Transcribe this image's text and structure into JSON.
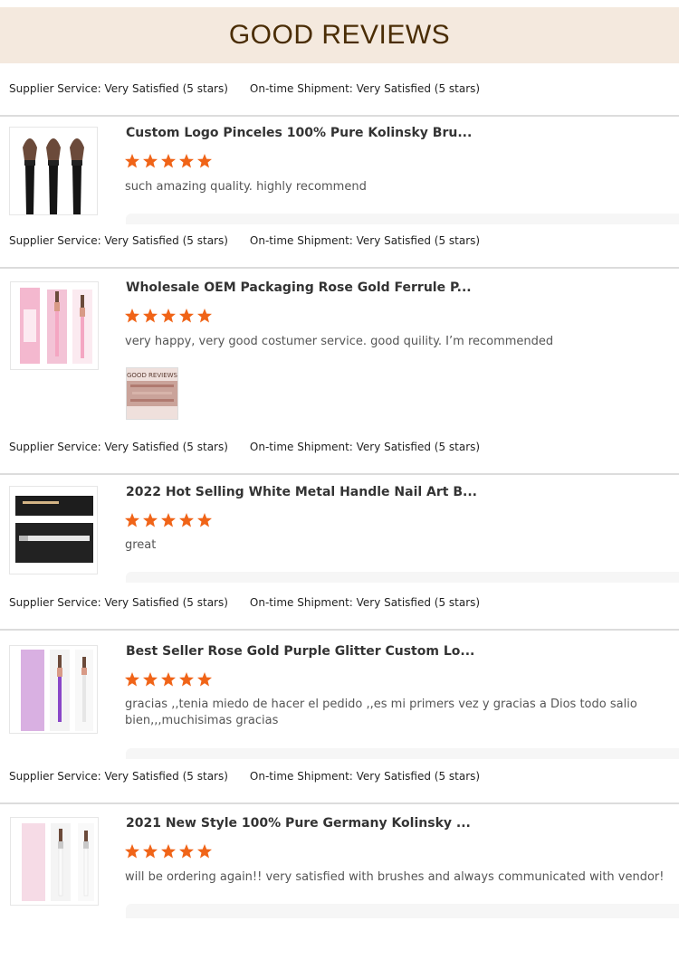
{
  "header": {
    "title": "GOOD REVIEWS"
  },
  "service_rating": {
    "supplier": "Supplier Service: Very Satisfied (5 stars)",
    "shipment": "On-time Shipment: Very Satisfied (5 stars)"
  },
  "reviews": [
    {
      "title": "Custom Logo Pinceles 100% Pure Kolinsky Bru...",
      "rating": 5,
      "comment": "such amazing quality. highly recommend"
    },
    {
      "title": "Wholesale OEM Packaging Rose Gold Ferrule P...",
      "rating": 5,
      "comment": "very happy, very good costumer service. good quility. I’m recommended",
      "photo_label": "GOOD REVIEWS"
    },
    {
      "title": "2022 Hot Selling White Metal Handle Nail Art B...",
      "rating": 5,
      "comment": "great"
    },
    {
      "title": "Best Seller Rose Gold Purple Glitter Custom Lo...",
      "rating": 5,
      "comment": "gracias ,,tenia miedo de hacer el pedido ,,es mi primers vez y gracias a Dios todo salio bien,,,muchisimas gracias"
    },
    {
      "title": "2021 New Style 100% Pure Germany Kolinsky ...",
      "rating": 5,
      "comment": "will be ordering again!! very satisfied with brushes and always communicated with vendor!"
    }
  ],
  "colors": {
    "star": "#f06418",
    "header_bg": "#f4e9de",
    "header_text": "#4a2d05"
  }
}
